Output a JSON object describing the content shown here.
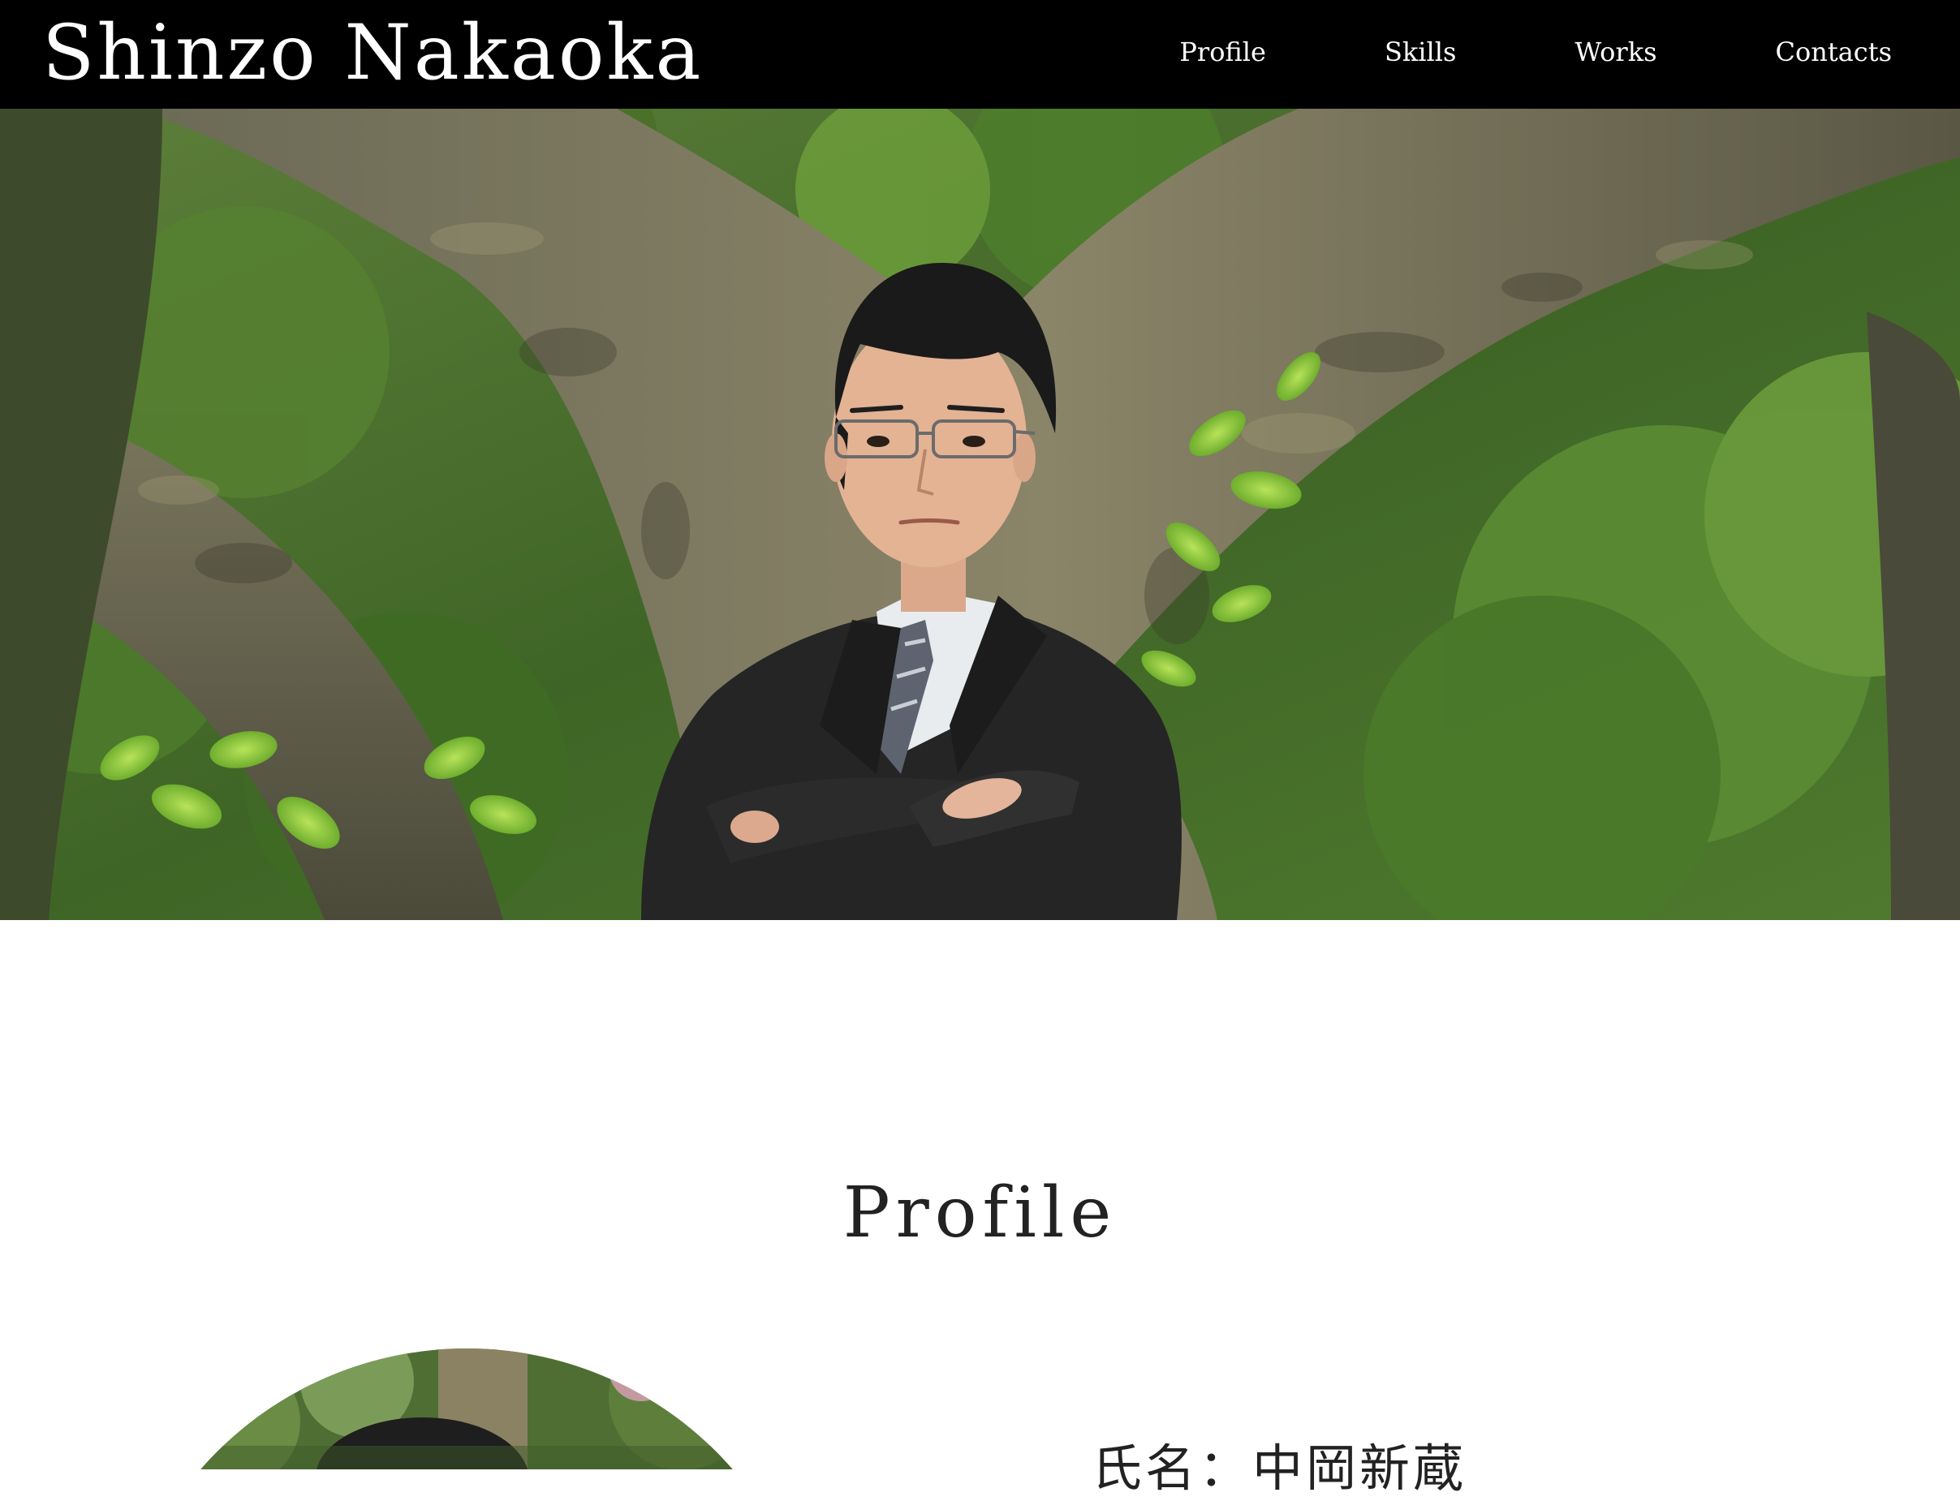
{
  "header": {
    "site_title": "Shinzo Nakaoka",
    "nav": {
      "profile": "Profile",
      "skills": "Skills",
      "works": "Works",
      "contacts": "Contacts"
    }
  },
  "hero": {
    "image": "portrait-photo-man-in-suit-in-front-of-tree"
  },
  "profile": {
    "heading": "Profile",
    "name_line": "氏名：中岡新蔵",
    "avatar": "circular-portrait-photo"
  },
  "colors": {
    "header_bg": "#000000",
    "header_text": "#ffffff",
    "page_bg": "#ffffff",
    "heading_text": "#222222"
  }
}
